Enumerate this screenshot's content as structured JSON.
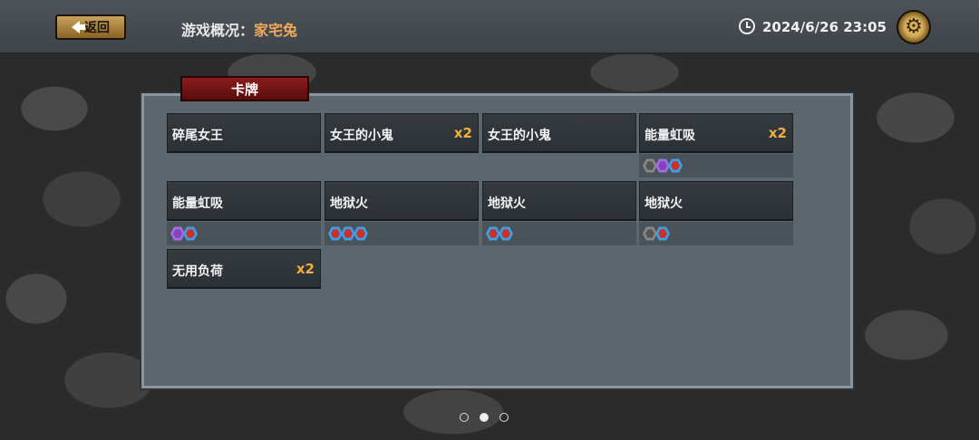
{
  "header": {
    "back_label": "返回",
    "title_label": "游戏概况：",
    "title_name": "家宅兔",
    "datetime": "2024/6/26 23:05"
  },
  "panel": {
    "tab_label": "卡牌",
    "cards": [
      {
        "name": "碎尾女王",
        "count": "",
        "gems": []
      },
      {
        "name": "女王的小鬼",
        "count": "x2",
        "gems": []
      },
      {
        "name": "女王的小鬼",
        "count": "",
        "gems": []
      },
      {
        "name": "能量虹吸",
        "count": "x2",
        "gems": [
          "grey-dark",
          "purple-green",
          "blue-red"
        ]
      },
      {
        "name": "能量虹吸",
        "count": "",
        "gems": [
          "purple-green",
          "blue-red"
        ]
      },
      {
        "name": "地狱火",
        "count": "",
        "gems": [
          "blue-red",
          "blue-red",
          "blue-red"
        ]
      },
      {
        "name": "地狱火",
        "count": "",
        "gems": [
          "blue-red",
          "blue-red"
        ]
      },
      {
        "name": "地狱火",
        "count": "",
        "gems": [
          "grey-red",
          "blue-red"
        ]
      },
      {
        "name": "无用负荷",
        "count": "x2",
        "gems": []
      }
    ]
  },
  "pagination": {
    "pages": 3,
    "current": 2
  },
  "colors": {
    "accent": "#f0a75a",
    "count": "#f0b040",
    "tab": "#8a1c1c"
  }
}
